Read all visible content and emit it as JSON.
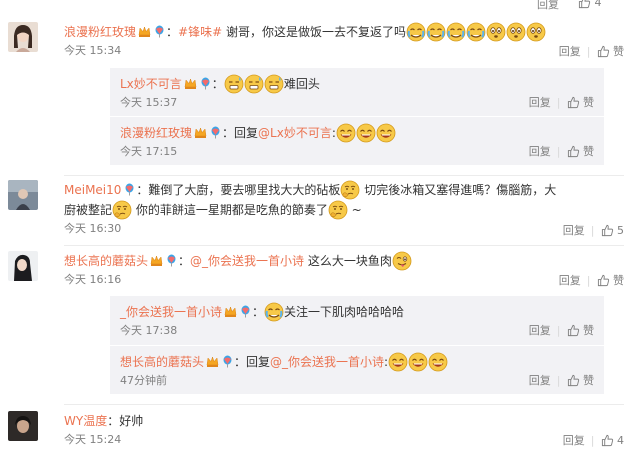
{
  "top": {
    "reply_label": "回复",
    "like_count": "4"
  },
  "actions": {
    "reply": "回复",
    "like": "赞"
  },
  "comments": [
    {
      "user": "浪漫粉红玫瑰",
      "tag": "#锋味#",
      "text": " 谢哥，你这是做饭一去不复返了吗",
      "time": "今天 15:34",
      "likes": "",
      "replies": [
        {
          "user": "Lx妙不可言",
          "text": "难回头",
          "time": "今天 15:37",
          "likes": ""
        },
        {
          "user": "浪漫粉红玫瑰",
          "prefix": "：回复",
          "mention": "@Lx妙不可言",
          "text": ":",
          "time": "今天 17:15",
          "likes": ""
        }
      ]
    },
    {
      "user": "MeiMei10",
      "text_a": "：難倒了大廚，要去哪里找大大的砧板",
      "text_b": " 切完後冰箱又塞得進嗎？傷腦筋，大廚被整記",
      "text_c": " 你的菲餅這一星期都是吃魚的節奏了",
      "text_d": " ~",
      "time": "今天 16:30",
      "likes": "5"
    },
    {
      "user": "想长高的蘑菇头",
      "mention": "@_你会送我一首小诗",
      "text": " 这么大一块鱼肉",
      "time": "今天 16:16",
      "likes": "",
      "replies": [
        {
          "user": "_你会送我一首小诗",
          "text": "关注一下肌肉哈哈哈哈",
          "time": "今天 17:38",
          "likes": ""
        },
        {
          "user": "想长高的蘑菇头",
          "prefix": "：回复",
          "mention": "@_你会送我一首小诗",
          "text": ":",
          "time": "47分钟前",
          "likes": ""
        }
      ]
    },
    {
      "user": "WY温度",
      "text": "：好帅",
      "time": "今天 15:24",
      "likes": "4"
    }
  ],
  "colors": {
    "name": "#eb7350",
    "time": "#808080",
    "reply_bg": "#f2f2f5"
  }
}
